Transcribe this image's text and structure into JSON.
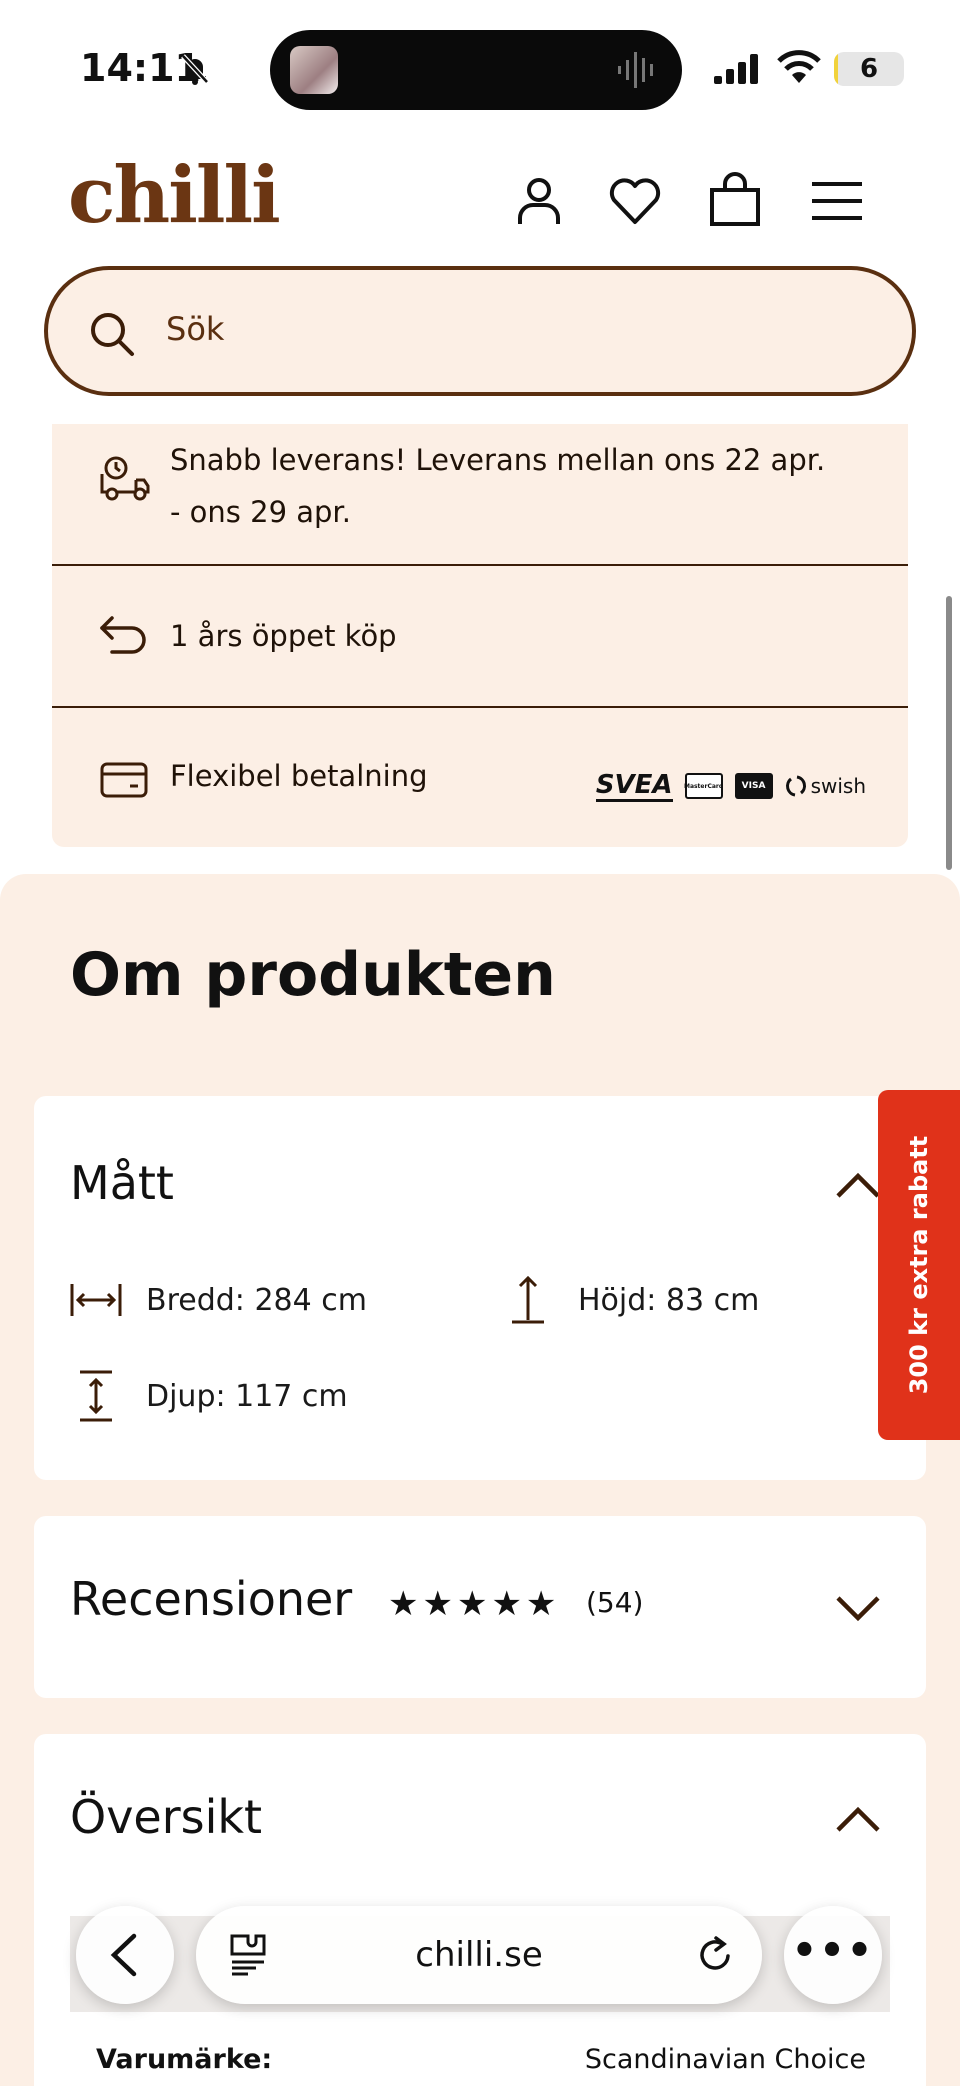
{
  "status_bar": {
    "time": "14:11",
    "battery": "6",
    "battery_level": 0.06
  },
  "header": {
    "logo": "chilli",
    "icons": [
      "account-icon",
      "heart-icon",
      "bag-icon",
      "menu-icon"
    ]
  },
  "search": {
    "placeholder": "Sök"
  },
  "info": {
    "delivery": "Snabb leverans! Leverans mellan ons 22 apr.",
    "delivery_line2": "- ons 29 apr.",
    "returns": "1 års öppet köp",
    "payment": "Flexibel betalning",
    "payment_logos": {
      "svea": "SVEA",
      "mastercard": "MasterCard",
      "visa": "VISA",
      "swish": "swish"
    }
  },
  "about": {
    "title": "Om produkten",
    "dimensions": {
      "title": "Mått",
      "width": "Bredd: 284 cm",
      "height": "Höjd: 83 cm",
      "depth": "Djup: 117 cm"
    },
    "reviews": {
      "title": "Recensioner",
      "stars": "★★★★★",
      "rating": 5,
      "count": "(54)"
    },
    "overview": {
      "title": "Översikt"
    },
    "spec": {
      "key": "Varumärke:",
      "value": "Scandinavian Choice"
    }
  },
  "promo": {
    "label": "300 kr extra rabatt"
  },
  "browser": {
    "url": "chilli.se",
    "more": "•••"
  },
  "colors": {
    "brand_brown": "#6b3613",
    "cream": "#fcefe5",
    "promo_red": "#e0321a"
  }
}
